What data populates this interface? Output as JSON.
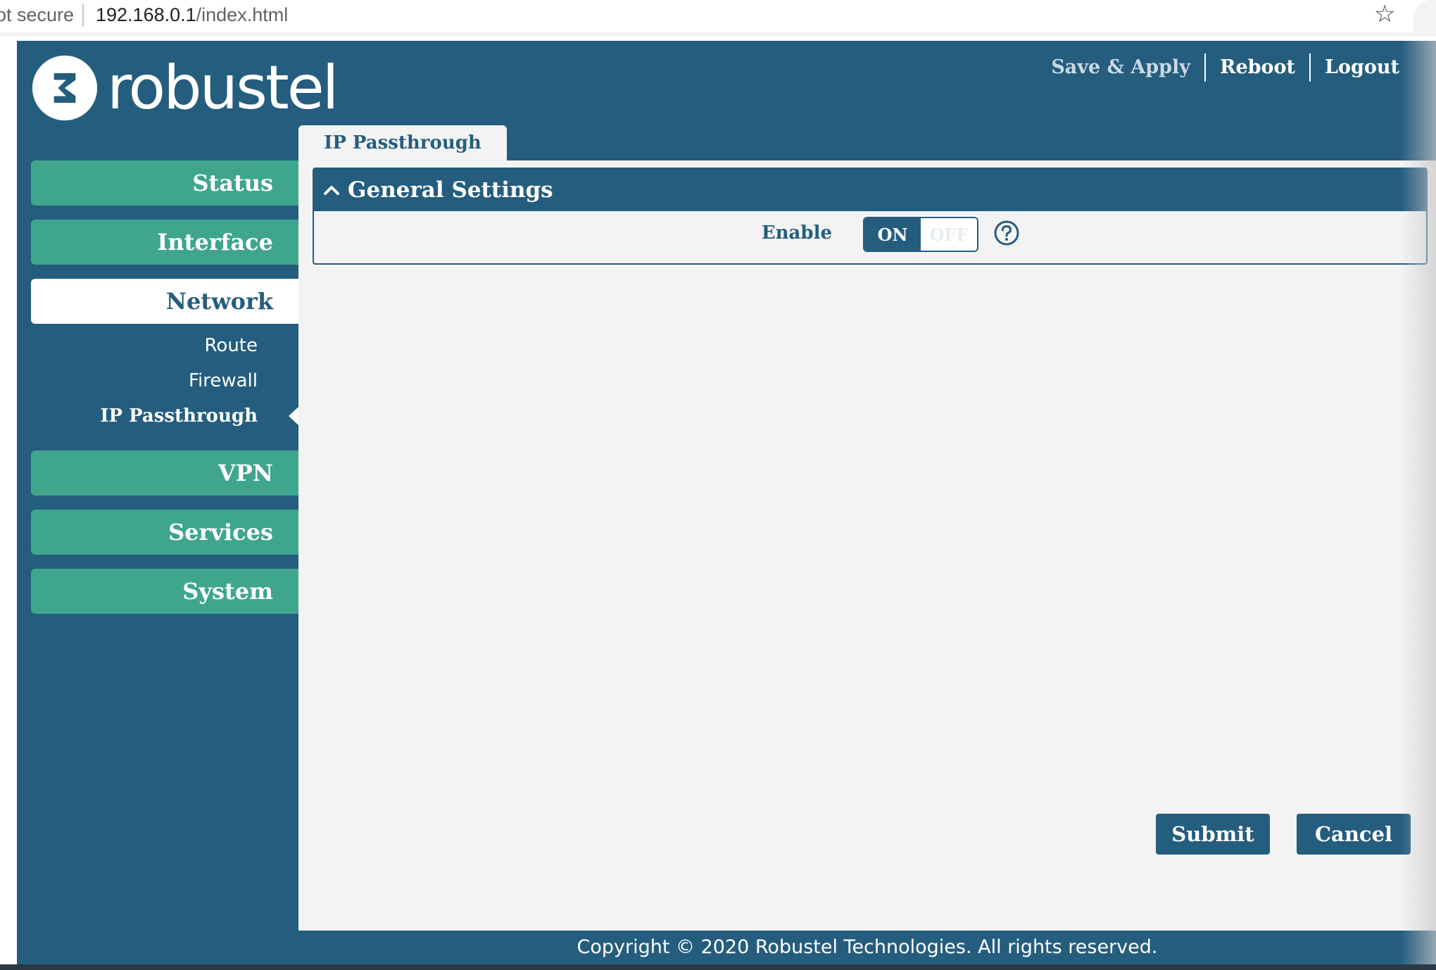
{
  "browser": {
    "security_text": "ot secure",
    "url_host": "192.168.0.1",
    "url_path": "/index.html"
  },
  "header": {
    "brand": "robustel",
    "links": [
      "Save & Apply",
      "Reboot",
      "Logout"
    ]
  },
  "sidebar": {
    "items": [
      {
        "label": "Status"
      },
      {
        "label": "Interface"
      },
      {
        "label": "Network",
        "active": true,
        "children": [
          "Route",
          "Firewall",
          "IP Passthrough"
        ]
      },
      {
        "label": "VPN"
      },
      {
        "label": "Services"
      },
      {
        "label": "System"
      }
    ]
  },
  "main": {
    "tab_label": "IP Passthrough",
    "section_title": "General Settings",
    "enable_label": "Enable",
    "toggle_on": "ON",
    "toggle_off": "OFF",
    "submit_label": "Submit",
    "cancel_label": "Cancel"
  },
  "footer": {
    "copyright": "Copyright © 2020 Robustel Technologies. All rights reserved."
  },
  "colors": {
    "primary": "#255d7e",
    "nav_green": "#3fa68d",
    "content_bg": "#f3f3f3"
  },
  "icons": [
    "star-icon",
    "robustel-logo-icon",
    "chevron-up-icon",
    "help-icon"
  ]
}
